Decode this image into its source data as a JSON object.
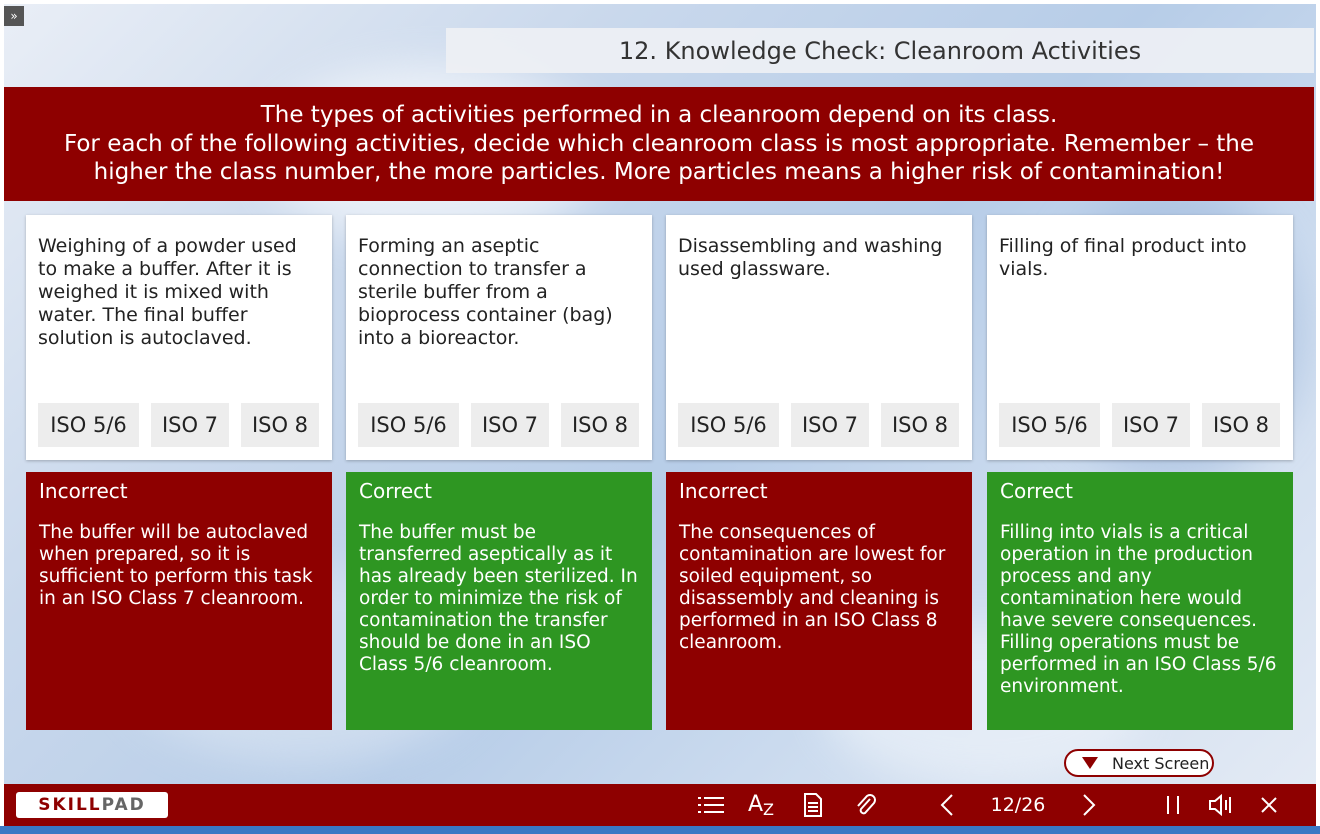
{
  "title": "12. Knowledge Check: Cleanroom Activities",
  "banner": {
    "line1": "The types of activities performed in a cleanroom depend on its class.",
    "line2": "For each of the following activities, decide which cleanroom class is most appropriate. Remember – the",
    "line3": "higher the class number, the more particles. More particles means a higher risk of contamination!"
  },
  "options": [
    "ISO 5/6",
    "ISO 7",
    "ISO 8"
  ],
  "cards": [
    {
      "question": "Weighing of a powder used to make a buffer. After it is weighed it is mixed with water. The final buffer solution is autoclaved.",
      "result": "Incorrect",
      "feedback": "The buffer will be autoclaved when prepared, so it is sufficient to perform this task in an ISO Class 7 cleanroom."
    },
    {
      "question": "Forming an aseptic connection to transfer a sterile buffer from a bioprocess container (bag) into a bioreactor.",
      "result": "Correct",
      "feedback": "The buffer must be transferred aseptically as it has already been sterilized. In order to minimize the risk of contamination the transfer should be done in an ISO Class 5/6 cleanroom."
    },
    {
      "question": "Disassembling and washing used glassware.",
      "result": "Incorrect",
      "feedback": "The consequences of contamination are lowest for soiled equipment, so disassembly and cleaning is performed in an ISO Class 8 cleanroom."
    },
    {
      "question": "Filling of final product into vials.",
      "result": "Correct",
      "feedback": "Filling into vials is a critical operation in the production process and any contamination here would have severe consequences. Filling operations must be performed in an ISO Class 5/6 environment."
    }
  ],
  "next_label": "Next Screen",
  "footer": {
    "logo_left": "SKILL",
    "logo_right": "PAD",
    "page": "12/26"
  },
  "colors": {
    "dark_red": "#8e0000",
    "green": "#2e9622"
  },
  "icons": [
    "expand-icon",
    "menu-list-icon",
    "glossary-icon",
    "document-icon",
    "attachment-icon",
    "previous-icon",
    "next-icon",
    "pause-icon",
    "audio-icon",
    "close-icon"
  ]
}
